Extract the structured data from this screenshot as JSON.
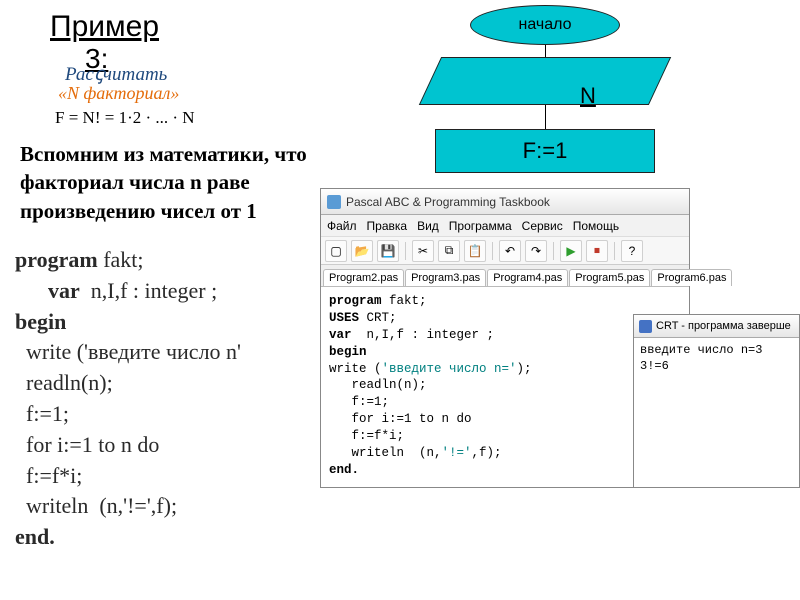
{
  "slide": {
    "title": "Пример",
    "number3": "3:",
    "rasch": "Расꞔчитать",
    "nfakt": "«N  факториал»",
    "formula": "F = N! = 1·2 · ... · N",
    "vspomnim_line1": "Вспомним из математики, что",
    "vspomnim_line2": "факториал числа n раве",
    "vspomnim_line3": "произведению чисел от 1"
  },
  "flow": {
    "start": "начало",
    "input": "N",
    "assign": "F:=1"
  },
  "pascal_source": {
    "lines": [
      {
        "kw": true,
        "text": "program fakt;"
      },
      {
        "kw_part": "      var",
        "rest": "  n,I,f : integer ;"
      },
      {
        "kw": true,
        "text": "begin"
      },
      {
        "text": "  write ('введите число n'"
      },
      {
        "text": "  readln(n);"
      },
      {
        "text": "  f:=1;"
      },
      {
        "text": "  for i:=1 to n do"
      },
      {
        "text": "  f:=f*i;"
      },
      {
        "text": "  writeln  (n,'!=',f);"
      },
      {
        "kw": true,
        "text": "end."
      }
    ]
  },
  "ide": {
    "title": "Pascal ABC & Programming Taskbook",
    "menu": [
      "Файл",
      "Правка",
      "Вид",
      "Программа",
      "Сервис",
      "Помощь"
    ],
    "toolbar_icons": [
      "new-icon",
      "open-icon",
      "save-icon",
      "sep",
      "cut-icon",
      "copy-icon",
      "paste-icon",
      "sep",
      "undo-icon",
      "redo-icon",
      "sep",
      "run-icon",
      "stop-icon",
      "sep",
      "help-icon"
    ],
    "tabs": [
      "Program2.pas",
      "Program3.pas",
      "Program4.pas",
      "Program5.pas",
      "Program6.pas"
    ],
    "code": [
      {
        "kw": "program",
        "rest": " fakt;"
      },
      {
        "kw": "USES",
        "rest": " CRT;"
      },
      {
        "kw": "var",
        "rest": "  n,I,f : integer ;"
      },
      {
        "kw": "begin",
        "rest": ""
      },
      {
        "plain": "write (",
        "str": "'введите число n='",
        "tail": ");"
      },
      {
        "plain": "   readln(n);"
      },
      {
        "plain": "   f:=1;"
      },
      {
        "plain": "   for i:=1 to n do"
      },
      {
        "plain": "   f:=f*i;"
      },
      {
        "plain": "   writeln  (n,",
        "str": "'!='",
        "tail": ",f);"
      },
      {
        "kw": "end.",
        "rest": ""
      }
    ]
  },
  "crt": {
    "title": "CRT - программа заверше",
    "out1": "введите число n=3",
    "out2": "3!=6"
  }
}
